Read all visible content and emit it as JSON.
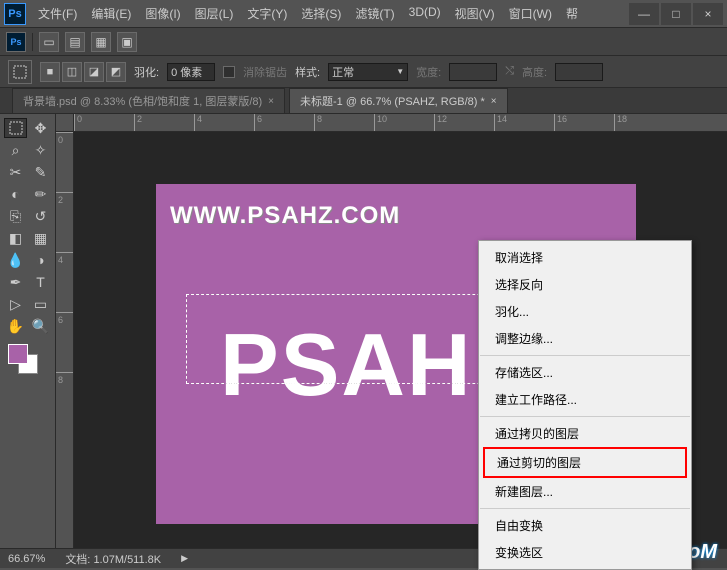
{
  "menubar": [
    "文件(F)",
    "编辑(E)",
    "图像(I)",
    "图层(L)",
    "文字(Y)",
    "选择(S)",
    "滤镜(T)",
    "3D(D)",
    "视图(V)",
    "窗口(W)",
    "帮"
  ],
  "options": {
    "feather_label": "羽化:",
    "feather_value": "0 像素",
    "antialias": "消除锯齿",
    "style_label": "样式:",
    "style_value": "正常",
    "width_label": "宽度:",
    "height_label": "高度:"
  },
  "tabs": [
    {
      "label": "背景墙.psd @ 8.33% (色相/饱和度 1, 图层蒙版/8)",
      "close": "×"
    },
    {
      "label": "未标题-1 @ 66.7% (PSAHZ, RGB/8) *",
      "close": "×"
    }
  ],
  "ruler_h": [
    "0",
    "2",
    "4",
    "6",
    "8",
    "10",
    "12",
    "14",
    "16",
    "18"
  ],
  "ruler_v": [
    "0",
    "2",
    "4",
    "6",
    "8"
  ],
  "canvas": {
    "watermark": "WWW.PSAHZ.COM",
    "bigtext": "PSAH"
  },
  "context": [
    {
      "t": "item",
      "label": "取消选择"
    },
    {
      "t": "item",
      "label": "选择反向"
    },
    {
      "t": "item",
      "label": "羽化..."
    },
    {
      "t": "item",
      "label": "调整边缘..."
    },
    {
      "t": "sep"
    },
    {
      "t": "item",
      "label": "存储选区..."
    },
    {
      "t": "item",
      "label": "建立工作路径..."
    },
    {
      "t": "sep"
    },
    {
      "t": "item",
      "label": "通过拷贝的图层"
    },
    {
      "t": "hl",
      "label": "通过剪切的图层"
    },
    {
      "t": "item",
      "label": "新建图层..."
    },
    {
      "t": "sep"
    },
    {
      "t": "item",
      "label": "自由变换"
    },
    {
      "t": "item",
      "label": "变换选区"
    }
  ],
  "status": {
    "zoom": "66.67%",
    "doc_label": "文档:",
    "doc_value": "1.07M/511.8K",
    "arrow": "▶"
  },
  "brand": "UiBQ.CoM",
  "icons": {
    "dash": "—",
    "square": "□",
    "x": "×",
    "tri": "▼",
    "swap": "⤭"
  }
}
